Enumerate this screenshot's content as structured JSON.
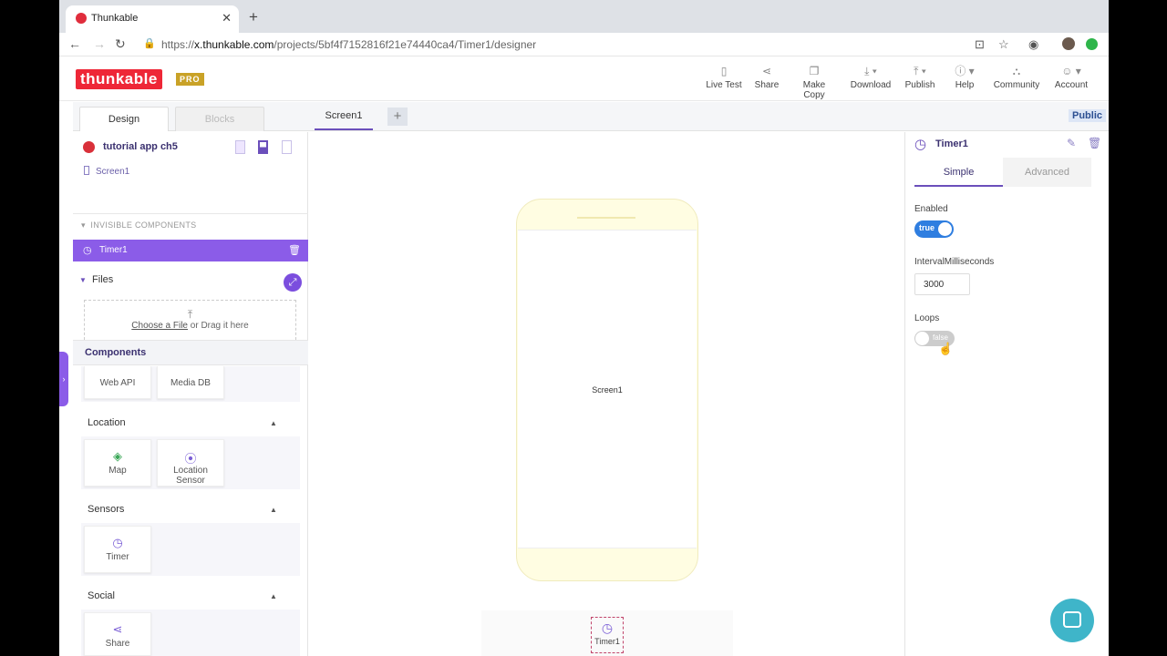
{
  "browser": {
    "tab_title": "Thunkable",
    "url_prefix": "https://",
    "url_host": "x.thunkable.com",
    "url_path": "/projects/5bf4f7152816f21e74440ca4/Timer1/designer"
  },
  "header": {
    "logo": "thunkable",
    "badge": "PRO",
    "tools": [
      {
        "label": "Live Test",
        "icon": "phone-icon"
      },
      {
        "label": "Share",
        "icon": "share-icon"
      },
      {
        "label": "Make Copy",
        "icon": "copy-icon"
      },
      {
        "label": "Download",
        "icon": "download-icon"
      },
      {
        "label": "Publish",
        "icon": "upload-icon"
      },
      {
        "label": "Help",
        "icon": "help-icon"
      },
      {
        "label": "Community",
        "icon": "community-icon"
      },
      {
        "label": "Account",
        "icon": "user-icon"
      }
    ]
  },
  "subbar": {
    "design_tab": "Design",
    "blocks_tab": "Blocks",
    "screen_tab": "Screen1",
    "add": "+",
    "public": "Public"
  },
  "left": {
    "project_name": "tutorial app ch5",
    "screen": "Screen1",
    "invisible_header": "INVISIBLE COMPONENTS",
    "timer_item": "Timer1",
    "files_header": "Files",
    "choose_file": "Choose a File",
    "drag_text": " or Drag it here",
    "components_header": "Components",
    "cards_top": [
      "Web API",
      "Media DB"
    ],
    "location_header": "Location",
    "location_cards": [
      "Map",
      "Location Sensor"
    ],
    "sensors_header": "Sensors",
    "sensor_cards": [
      "Timer"
    ],
    "social_header": "Social",
    "social_cards": [
      "Share"
    ]
  },
  "canvas": {
    "screen_label": "Screen1",
    "invisible_timer": "Timer1"
  },
  "properties": {
    "component": "Timer1",
    "tab_simple": "Simple",
    "tab_advanced": "Advanced",
    "enabled_label": "Enabled",
    "enabled_value": "true",
    "interval_label": "IntervalMilliseconds",
    "interval_value": "3000",
    "loops_label": "Loops",
    "loops_value": "false"
  },
  "colors": {
    "brand_red": "#ee2737",
    "accent_purple": "#8b5ce8",
    "toggle_blue": "#2f7ee0",
    "chat_teal": "#3fb5c9"
  }
}
